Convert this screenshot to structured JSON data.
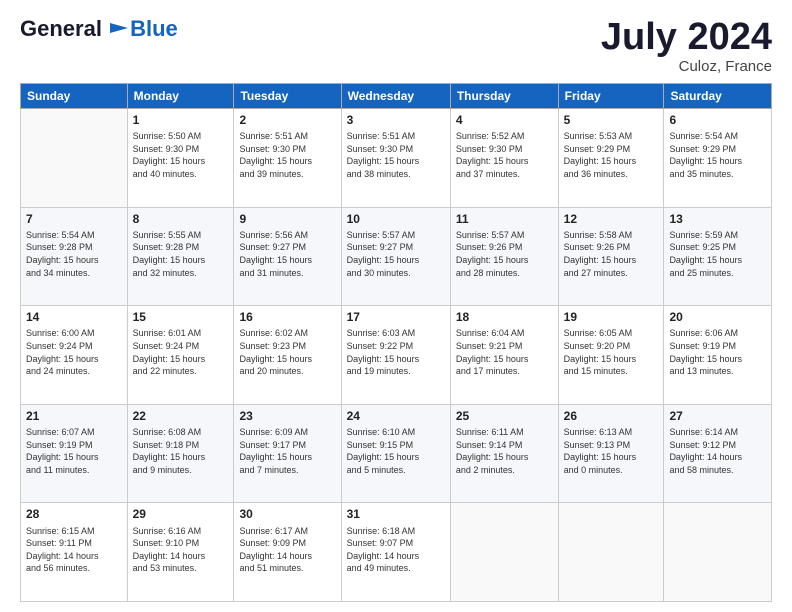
{
  "header": {
    "logo_line1": "General",
    "logo_line2": "Blue",
    "title": "July 2024",
    "location": "Culoz, France"
  },
  "columns": [
    "Sunday",
    "Monday",
    "Tuesday",
    "Wednesday",
    "Thursday",
    "Friday",
    "Saturday"
  ],
  "weeks": [
    [
      {
        "day": "",
        "info": ""
      },
      {
        "day": "1",
        "info": "Sunrise: 5:50 AM\nSunset: 9:30 PM\nDaylight: 15 hours\nand 40 minutes."
      },
      {
        "day": "2",
        "info": "Sunrise: 5:51 AM\nSunset: 9:30 PM\nDaylight: 15 hours\nand 39 minutes."
      },
      {
        "day": "3",
        "info": "Sunrise: 5:51 AM\nSunset: 9:30 PM\nDaylight: 15 hours\nand 38 minutes."
      },
      {
        "day": "4",
        "info": "Sunrise: 5:52 AM\nSunset: 9:30 PM\nDaylight: 15 hours\nand 37 minutes."
      },
      {
        "day": "5",
        "info": "Sunrise: 5:53 AM\nSunset: 9:29 PM\nDaylight: 15 hours\nand 36 minutes."
      },
      {
        "day": "6",
        "info": "Sunrise: 5:54 AM\nSunset: 9:29 PM\nDaylight: 15 hours\nand 35 minutes."
      }
    ],
    [
      {
        "day": "7",
        "info": "Sunrise: 5:54 AM\nSunset: 9:28 PM\nDaylight: 15 hours\nand 34 minutes."
      },
      {
        "day": "8",
        "info": "Sunrise: 5:55 AM\nSunset: 9:28 PM\nDaylight: 15 hours\nand 32 minutes."
      },
      {
        "day": "9",
        "info": "Sunrise: 5:56 AM\nSunset: 9:27 PM\nDaylight: 15 hours\nand 31 minutes."
      },
      {
        "day": "10",
        "info": "Sunrise: 5:57 AM\nSunset: 9:27 PM\nDaylight: 15 hours\nand 30 minutes."
      },
      {
        "day": "11",
        "info": "Sunrise: 5:57 AM\nSunset: 9:26 PM\nDaylight: 15 hours\nand 28 minutes."
      },
      {
        "day": "12",
        "info": "Sunrise: 5:58 AM\nSunset: 9:26 PM\nDaylight: 15 hours\nand 27 minutes."
      },
      {
        "day": "13",
        "info": "Sunrise: 5:59 AM\nSunset: 9:25 PM\nDaylight: 15 hours\nand 25 minutes."
      }
    ],
    [
      {
        "day": "14",
        "info": "Sunrise: 6:00 AM\nSunset: 9:24 PM\nDaylight: 15 hours\nand 24 minutes."
      },
      {
        "day": "15",
        "info": "Sunrise: 6:01 AM\nSunset: 9:24 PM\nDaylight: 15 hours\nand 22 minutes."
      },
      {
        "day": "16",
        "info": "Sunrise: 6:02 AM\nSunset: 9:23 PM\nDaylight: 15 hours\nand 20 minutes."
      },
      {
        "day": "17",
        "info": "Sunrise: 6:03 AM\nSunset: 9:22 PM\nDaylight: 15 hours\nand 19 minutes."
      },
      {
        "day": "18",
        "info": "Sunrise: 6:04 AM\nSunset: 9:21 PM\nDaylight: 15 hours\nand 17 minutes."
      },
      {
        "day": "19",
        "info": "Sunrise: 6:05 AM\nSunset: 9:20 PM\nDaylight: 15 hours\nand 15 minutes."
      },
      {
        "day": "20",
        "info": "Sunrise: 6:06 AM\nSunset: 9:19 PM\nDaylight: 15 hours\nand 13 minutes."
      }
    ],
    [
      {
        "day": "21",
        "info": "Sunrise: 6:07 AM\nSunset: 9:19 PM\nDaylight: 15 hours\nand 11 minutes."
      },
      {
        "day": "22",
        "info": "Sunrise: 6:08 AM\nSunset: 9:18 PM\nDaylight: 15 hours\nand 9 minutes."
      },
      {
        "day": "23",
        "info": "Sunrise: 6:09 AM\nSunset: 9:17 PM\nDaylight: 15 hours\nand 7 minutes."
      },
      {
        "day": "24",
        "info": "Sunrise: 6:10 AM\nSunset: 9:15 PM\nDaylight: 15 hours\nand 5 minutes."
      },
      {
        "day": "25",
        "info": "Sunrise: 6:11 AM\nSunset: 9:14 PM\nDaylight: 15 hours\nand 2 minutes."
      },
      {
        "day": "26",
        "info": "Sunrise: 6:13 AM\nSunset: 9:13 PM\nDaylight: 15 hours\nand 0 minutes."
      },
      {
        "day": "27",
        "info": "Sunrise: 6:14 AM\nSunset: 9:12 PM\nDaylight: 14 hours\nand 58 minutes."
      }
    ],
    [
      {
        "day": "28",
        "info": "Sunrise: 6:15 AM\nSunset: 9:11 PM\nDaylight: 14 hours\nand 56 minutes."
      },
      {
        "day": "29",
        "info": "Sunrise: 6:16 AM\nSunset: 9:10 PM\nDaylight: 14 hours\nand 53 minutes."
      },
      {
        "day": "30",
        "info": "Sunrise: 6:17 AM\nSunset: 9:09 PM\nDaylight: 14 hours\nand 51 minutes."
      },
      {
        "day": "31",
        "info": "Sunrise: 6:18 AM\nSunset: 9:07 PM\nDaylight: 14 hours\nand 49 minutes."
      },
      {
        "day": "",
        "info": ""
      },
      {
        "day": "",
        "info": ""
      },
      {
        "day": "",
        "info": ""
      }
    ]
  ]
}
